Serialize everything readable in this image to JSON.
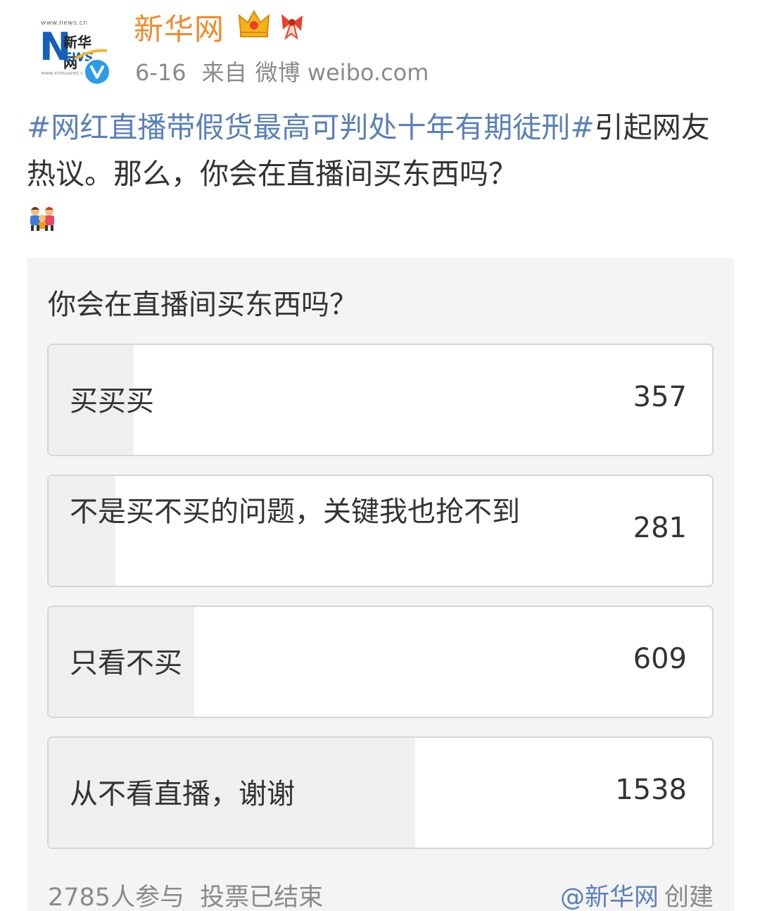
{
  "header": {
    "account_name": "新华网",
    "avatar_text_url": "www.news.cn",
    "avatar_text_cn": "新华网",
    "avatar_text_news_n": "N",
    "avatar_text_news_rest": "EWS",
    "avatar_text_url2": "www.xinhuanet.com",
    "date": "6-16",
    "source_prefix": "来自",
    "source": "微博 weibo.com",
    "badges": [
      "crown-icon",
      "ribbon-icon"
    ],
    "verified_icon": "verified-v-icon"
  },
  "post": {
    "hashtag": "#网红直播带假货最高可判处十年有期徒刑#",
    "text": "引起网友热议。那么，你会在直播间买东西吗？",
    "emoji": "people-emoji-icon"
  },
  "poll": {
    "question": "你会在直播间买东西吗？",
    "total_votes": 2785,
    "options": [
      {
        "label": "买买买",
        "count": "357",
        "share": 0.128
      },
      {
        "label": "不是买不买的问题，关键我也抢不到",
        "count": "281",
        "share": 0.101
      },
      {
        "label": "只看不买",
        "count": "609",
        "share": 0.219
      },
      {
        "label": "从不看直播，谢谢",
        "count": "1538",
        "share": 0.552
      }
    ],
    "footer_participants": "2785人参与",
    "footer_status": "投票已结束",
    "creator_link": "@新华网",
    "creator_suffix": "创建"
  },
  "colors": {
    "name": "#f08a2d",
    "hashtag": "#5b80b8",
    "meta": "#8a8a8a",
    "verified": "#2a9ce8",
    "bar_fill": "#efefef"
  }
}
